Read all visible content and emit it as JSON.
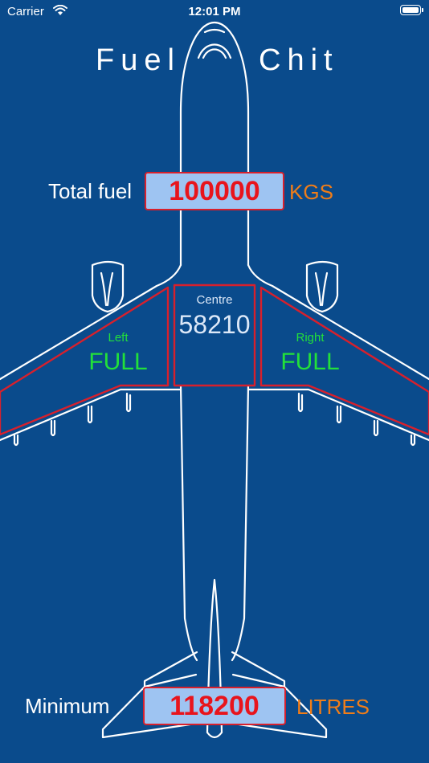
{
  "status_bar": {
    "carrier": "Carrier",
    "time": "12:01 PM"
  },
  "app": {
    "title_left": "Fuel",
    "title_right": "Chit"
  },
  "total_fuel": {
    "label": "Total fuel",
    "value": "100000",
    "unit": "KGS"
  },
  "tanks": {
    "centre": {
      "label": "Centre",
      "value": "58210"
    },
    "left": {
      "label": "Left",
      "value": "FULL"
    },
    "right": {
      "label": "Right",
      "value": "FULL"
    }
  },
  "minimum": {
    "label": "Minimum",
    "value": "118200",
    "unit": "LITRES"
  },
  "colors": {
    "background": "#0a4b8c",
    "input_fill": "#9ec4f2",
    "value_red": "#e8141c",
    "tank_outline": "#d8202c",
    "unit_orange": "#f07d18",
    "tank_green": "#22e03a"
  }
}
